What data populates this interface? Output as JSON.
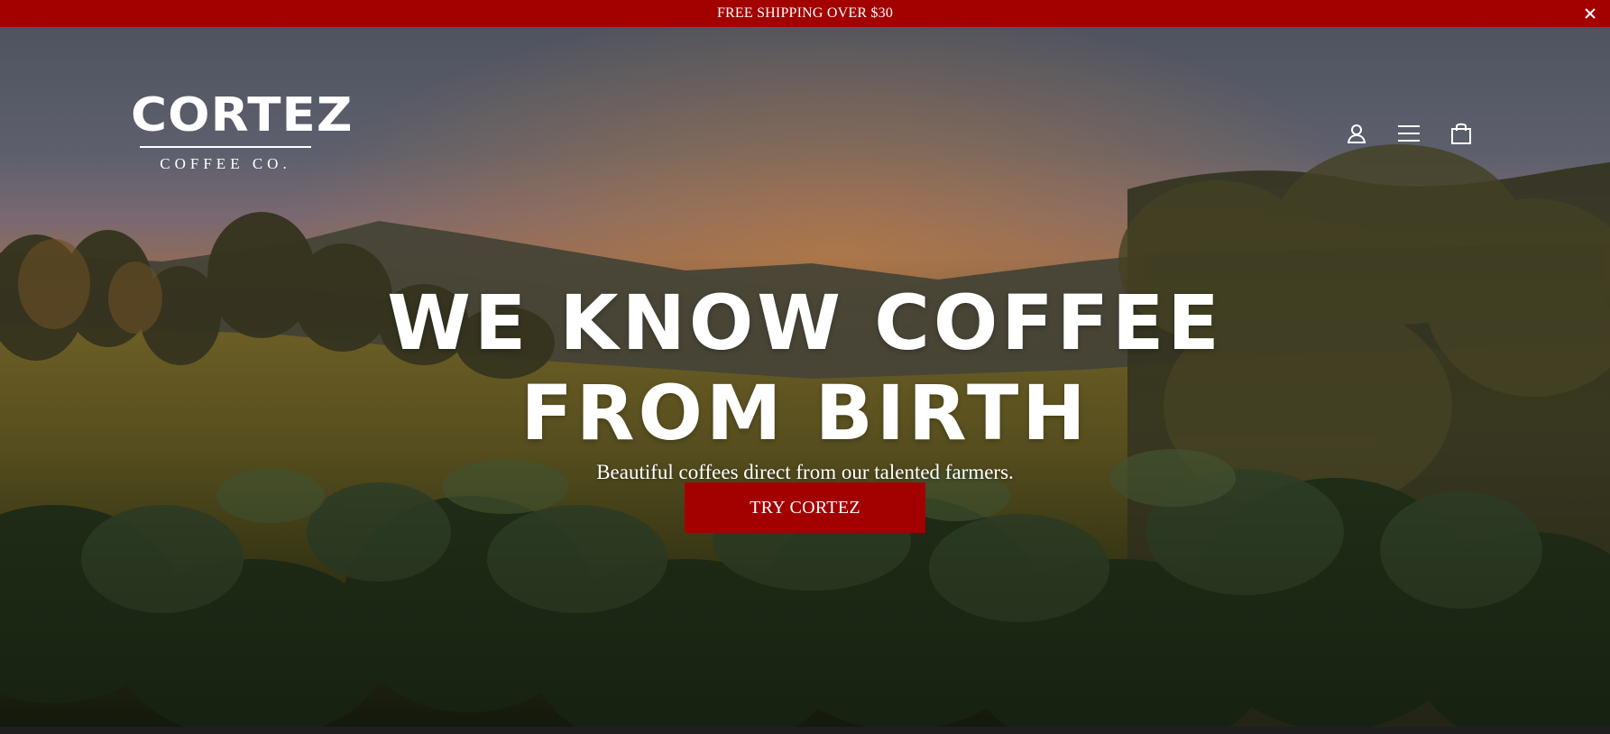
{
  "announcement": {
    "text": "FREE SHIPPING OVER $30",
    "close_icon": "close-icon"
  },
  "header": {
    "logo": {
      "word": "CORTEZ",
      "tagline": "COFFEE CO."
    },
    "icons": [
      "account-icon",
      "menu-icon",
      "cart-icon"
    ]
  },
  "hero": {
    "headline_line1": "WE KNOW COFFEE",
    "headline_line2": "FROM BIRTH",
    "subhead": "Beautiful coffees direct from our talented farmers.",
    "cta_label": "TRY CORTEZ"
  },
  "colors": {
    "brand_red": "#a30000",
    "text_light": "#ffffff"
  }
}
